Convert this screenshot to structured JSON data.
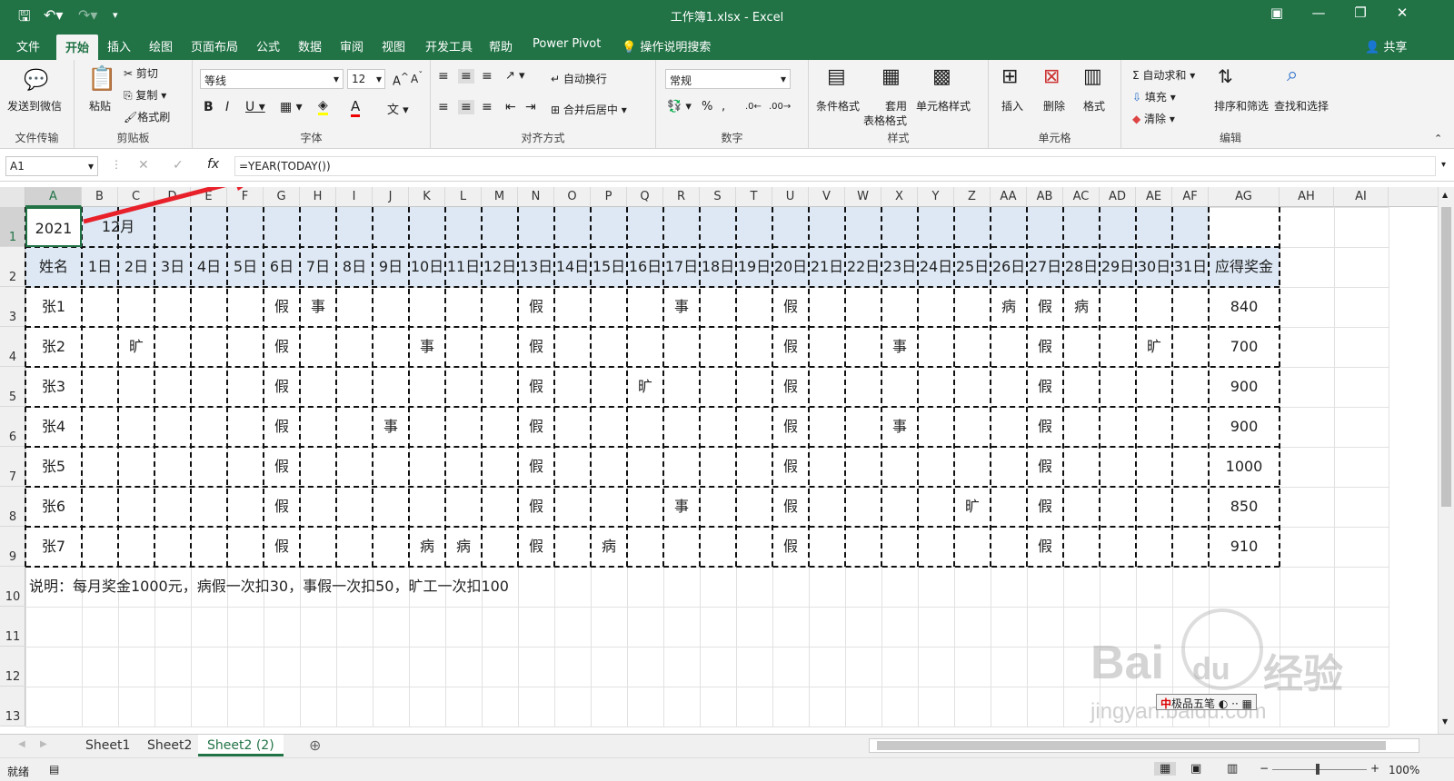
{
  "window": {
    "title": "工作簿1.xlsx - Excel",
    "share": "共享"
  },
  "ribbon_tabs": [
    "文件",
    "开始",
    "插入",
    "绘图",
    "页面布局",
    "公式",
    "数据",
    "审阅",
    "视图",
    "开发工具",
    "帮助",
    "Power Pivot"
  ],
  "tell_me": "操作说明搜索",
  "ribbon": {
    "send_wechat": "发送到微信",
    "file_transfer": "文件传输",
    "paste": "粘贴",
    "cut": "剪切",
    "copy": "复制",
    "format_painter": "格式刷",
    "clipboard": "剪贴板",
    "font_name": "等线",
    "font_size": "12",
    "font_group": "字体",
    "wrap_text": "自动换行",
    "merge_center": "合并后居中",
    "align_group": "对齐方式",
    "number_format": "常规",
    "number_group": "数字",
    "cond_format": "条件格式",
    "table_format_1": "套用",
    "table_format_2": "表格格式",
    "cell_styles": "单元格样式",
    "styles_group": "样式",
    "insert": "插入",
    "delete": "删除",
    "format": "格式",
    "cells_group": "单元格",
    "autosum": "自动求和",
    "fill": "填充",
    "clear": "清除",
    "sort_filter": "排序和筛选",
    "find_select": "查找和选择",
    "edit_group": "编辑"
  },
  "formula_bar": {
    "name_box": "A1",
    "formula": "=YEAR(TODAY())"
  },
  "columns": [
    "A",
    "B",
    "C",
    "D",
    "E",
    "F",
    "G",
    "H",
    "I",
    "J",
    "K",
    "L",
    "M",
    "N",
    "O",
    "P",
    "Q",
    "R",
    "S",
    "T",
    "U",
    "V",
    "W",
    "X",
    "Y",
    "Z",
    "AA",
    "AB",
    "AC",
    "AD",
    "AE",
    "AF",
    "AG",
    "AH",
    "AI"
  ],
  "rows": [
    "1",
    "2",
    "3",
    "4",
    "5",
    "6",
    "7",
    "8",
    "9",
    "10",
    "11",
    "12",
    "13"
  ],
  "sheet": {
    "year": "2021",
    "month": "12月",
    "name_header": "姓名",
    "bonus_header": "应得奖金",
    "days": [
      "1日",
      "2日",
      "3日",
      "4日",
      "5日",
      "6日",
      "7日",
      "8日",
      "9日",
      "10日",
      "11日",
      "12日",
      "13日",
      "14日",
      "15日",
      "16日",
      "17日",
      "18日",
      "19日",
      "20日",
      "21日",
      "22日",
      "23日",
      "24日",
      "25日",
      "26日",
      "27日",
      "28日",
      "29日",
      "30日",
      "31日"
    ],
    "employees": [
      {
        "name": "张1",
        "bonus": "840",
        "marks": {
          "6": "假",
          "7": "事",
          "13": "假",
          "17": "事",
          "20": "假",
          "26": "病",
          "27": "假",
          "28": "病"
        }
      },
      {
        "name": "张2",
        "bonus": "700",
        "marks": {
          "2": "旷",
          "6": "假",
          "10": "事",
          "13": "假",
          "20": "假",
          "23": "事",
          "27": "假",
          "30": "旷"
        }
      },
      {
        "name": "张3",
        "bonus": "900",
        "marks": {
          "6": "假",
          "13": "假",
          "16": "旷",
          "20": "假",
          "27": "假"
        }
      },
      {
        "name": "张4",
        "bonus": "900",
        "marks": {
          "6": "假",
          "9": "事",
          "13": "假",
          "20": "假",
          "23": "事",
          "27": "假"
        }
      },
      {
        "name": "张5",
        "bonus": "1000",
        "marks": {
          "6": "假",
          "13": "假",
          "20": "假",
          "27": "假"
        }
      },
      {
        "name": "张6",
        "bonus": "850",
        "marks": {
          "6": "假",
          "13": "假",
          "17": "事",
          "20": "假",
          "25": "旷",
          "27": "假"
        }
      },
      {
        "name": "张7",
        "bonus": "910",
        "marks": {
          "6": "假",
          "10": "病",
          "11": "病",
          "13": "假",
          "15": "病",
          "20": "假",
          "27": "假"
        }
      }
    ],
    "note": "说明：每月奖金1000元，病假一次扣30，事假一次扣50，旷工一次扣100"
  },
  "sheet_tabs": [
    "Sheet1",
    "Sheet2",
    "Sheet2 (2)"
  ],
  "active_sheet": "Sheet2 (2)",
  "status": {
    "ready": "就绪",
    "zoom": "100%"
  },
  "watermark": {
    "brand": "Bai",
    "brand2": "du",
    "brand3": "经验",
    "url": "jingyan.baidu.com",
    "ime": "极品五笔"
  },
  "colors": {
    "excel_green": "#217346",
    "header_fill": "#dde8f4",
    "annotation_arrow": "#e8202a"
  }
}
